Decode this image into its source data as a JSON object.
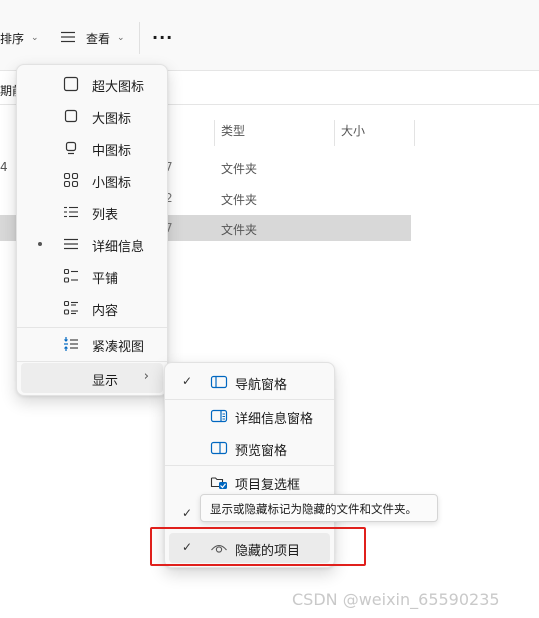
{
  "toolbar": {
    "sort_label": "排序",
    "view_label": "查看",
    "more_label": "···"
  },
  "address": {
    "text": "期前"
  },
  "columns": {
    "type": "类型",
    "size": "大小"
  },
  "rows": [
    {
      "lead": "4",
      "frag": "7",
      "type": "文件夹",
      "selected": false
    },
    {
      "lead": "",
      "frag": "2",
      "type": "文件夹",
      "selected": false
    },
    {
      "lead": "",
      "frag": "7",
      "type": "文件夹",
      "selected": true
    }
  ],
  "view_menu": {
    "items": [
      {
        "label": "超大图标",
        "icon": "extra-large-icons-icon"
      },
      {
        "label": "大图标",
        "icon": "large-icons-icon"
      },
      {
        "label": "中图标",
        "icon": "medium-icons-icon"
      },
      {
        "label": "小图标",
        "icon": "small-icons-icon"
      },
      {
        "label": "列表",
        "icon": "list-icon"
      },
      {
        "label": "详细信息",
        "icon": "details-icon",
        "selected": true
      },
      {
        "label": "平铺",
        "icon": "tiles-icon"
      },
      {
        "label": "内容",
        "icon": "content-icon"
      },
      {
        "label": "紧凑视图",
        "icon": "compact-view-icon"
      },
      {
        "label": "显示",
        "icon": "",
        "submenu": true
      }
    ]
  },
  "show_menu": {
    "items": [
      {
        "label": "导航窗格",
        "checked": true,
        "icon": "navigation-pane-icon"
      },
      {
        "label": "详细信息窗格",
        "checked": false,
        "icon": "details-pane-icon"
      },
      {
        "label": "预览窗格",
        "checked": false,
        "icon": "preview-pane-icon"
      },
      {
        "label": "项目复选框",
        "checked": true,
        "icon": "item-checkbox-icon"
      },
      {
        "label": "隐藏的项目",
        "checked": true,
        "icon": "hidden-items-icon"
      }
    ]
  },
  "tooltip": {
    "text": "显示或隐藏标记为隐藏的文件和文件夹。"
  },
  "watermark": {
    "text": "CSDN @weixin_65590235"
  },
  "colors": {
    "accent": "#0067c0",
    "highlight_box": "#e0201c"
  }
}
